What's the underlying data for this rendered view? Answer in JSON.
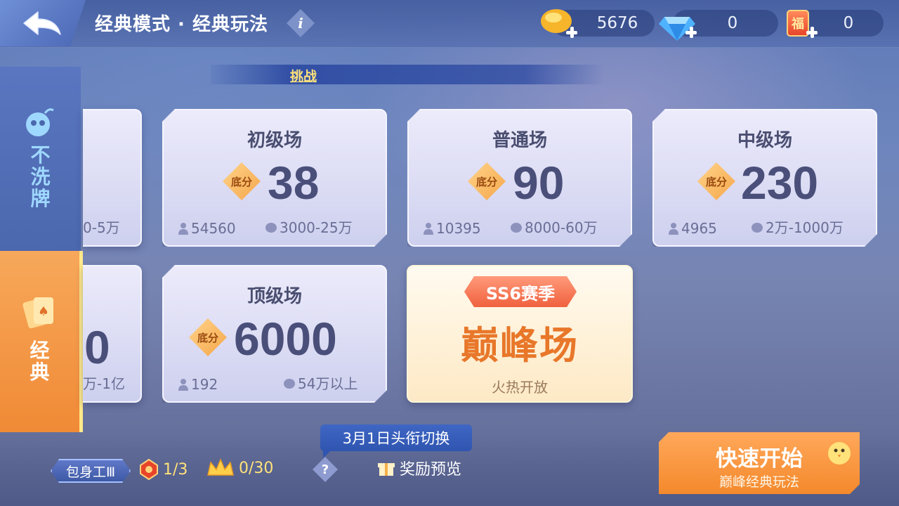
{
  "header": {
    "title": "经典模式 · 经典玩法",
    "info_icon": "info-icon",
    "currencies": [
      {
        "name": "gold-bean",
        "value": "5676"
      },
      {
        "name": "diamond",
        "value": "0"
      },
      {
        "name": "fu-card",
        "value": "0",
        "icon_text": "福"
      }
    ]
  },
  "challenge": {
    "label": "挑战"
  },
  "side_tabs": [
    {
      "label": "不洗牌",
      "chars": [
        "不",
        "洗",
        "牌"
      ],
      "active": false
    },
    {
      "label": "经典",
      "chars": [
        "经",
        "典"
      ],
      "active": true
    }
  ],
  "cards": [
    {
      "id": "beginner",
      "name": "初级场",
      "base_label": "底分",
      "base_value": "38",
      "players": "54560",
      "bean_range": "3000-25万"
    },
    {
      "id": "normal",
      "name": "普通场",
      "base_label": "底分",
      "base_value": "90",
      "players": "10395",
      "bean_range": "8000-60万"
    },
    {
      "id": "middle",
      "name": "中级场",
      "base_label": "底分",
      "base_value": "230",
      "players": "4965",
      "bean_range": "2万-1000万"
    },
    {
      "id": "top",
      "name": "顶级场",
      "base_label": "底分",
      "base_value": "6000",
      "players": "192",
      "bean_range": "54万以上"
    }
  ],
  "partial_cards": [
    {
      "visible_range": "0-5万"
    },
    {
      "visible_value": "0",
      "visible_range": "万-1亿"
    }
  ],
  "peak": {
    "season": "SS6赛季",
    "title": "巅峰场",
    "subtitle": "火热开放"
  },
  "bottom": {
    "rank_title": "包身工Ⅲ",
    "progress_a": "1/3",
    "progress_b": "0/30",
    "tip": "3月1日头衔切换",
    "help": "?",
    "reward_preview": "奖励预览"
  },
  "quick_start": {
    "label": "快速开始",
    "sub": "巅峰经典玩法"
  },
  "colors": {
    "accent_orange": "#f08a36",
    "title_yellow": "#ffe27a",
    "card_text": "#4a4f7a"
  }
}
